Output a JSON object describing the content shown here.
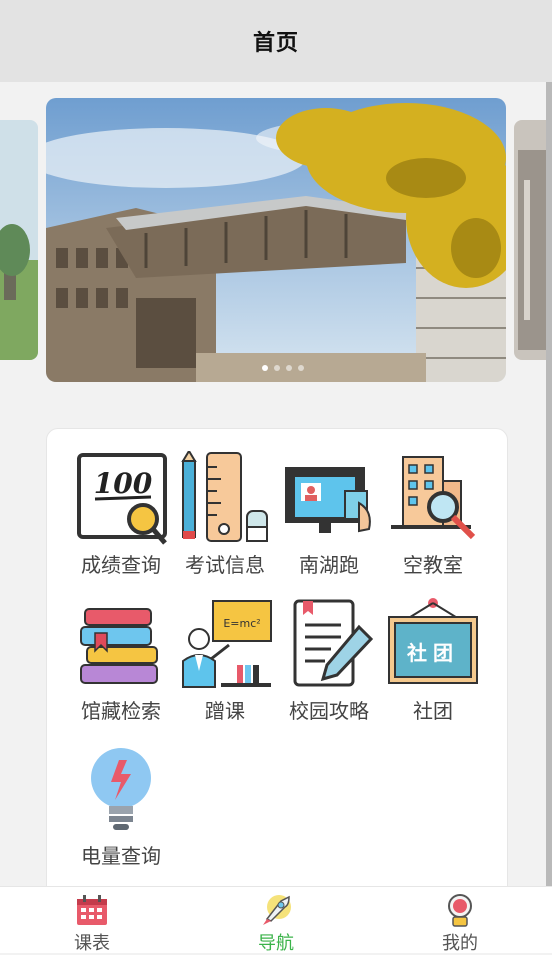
{
  "header": {
    "title": "首页"
  },
  "banner": {
    "slides": 4,
    "active_slide": 0
  },
  "grid": {
    "items": [
      {
        "label": "成绩查询",
        "icon": "score-icon"
      },
      {
        "label": "考试信息",
        "icon": "exam-icon"
      },
      {
        "label": "南湖跑",
        "icon": "run-icon"
      },
      {
        "label": "空教室",
        "icon": "classroom-icon"
      },
      {
        "label": "馆藏检索",
        "icon": "library-icon"
      },
      {
        "label": "蹭课",
        "icon": "lecture-icon"
      },
      {
        "label": "校园攻略",
        "icon": "guide-icon"
      },
      {
        "label": "社团",
        "icon": "club-icon",
        "sign_text": "社团"
      },
      {
        "label": "电量查询",
        "icon": "electricity-icon"
      }
    ]
  },
  "tabbar": {
    "tabs": [
      {
        "label": "课表",
        "icon": "calendar-icon"
      },
      {
        "label": "导航",
        "icon": "rocket-icon",
        "active": true
      },
      {
        "label": "我的",
        "icon": "astronaut-icon"
      }
    ]
  },
  "colors": {
    "active_tab": "#3bb34a",
    "header_bg": "#e3e3e3"
  }
}
